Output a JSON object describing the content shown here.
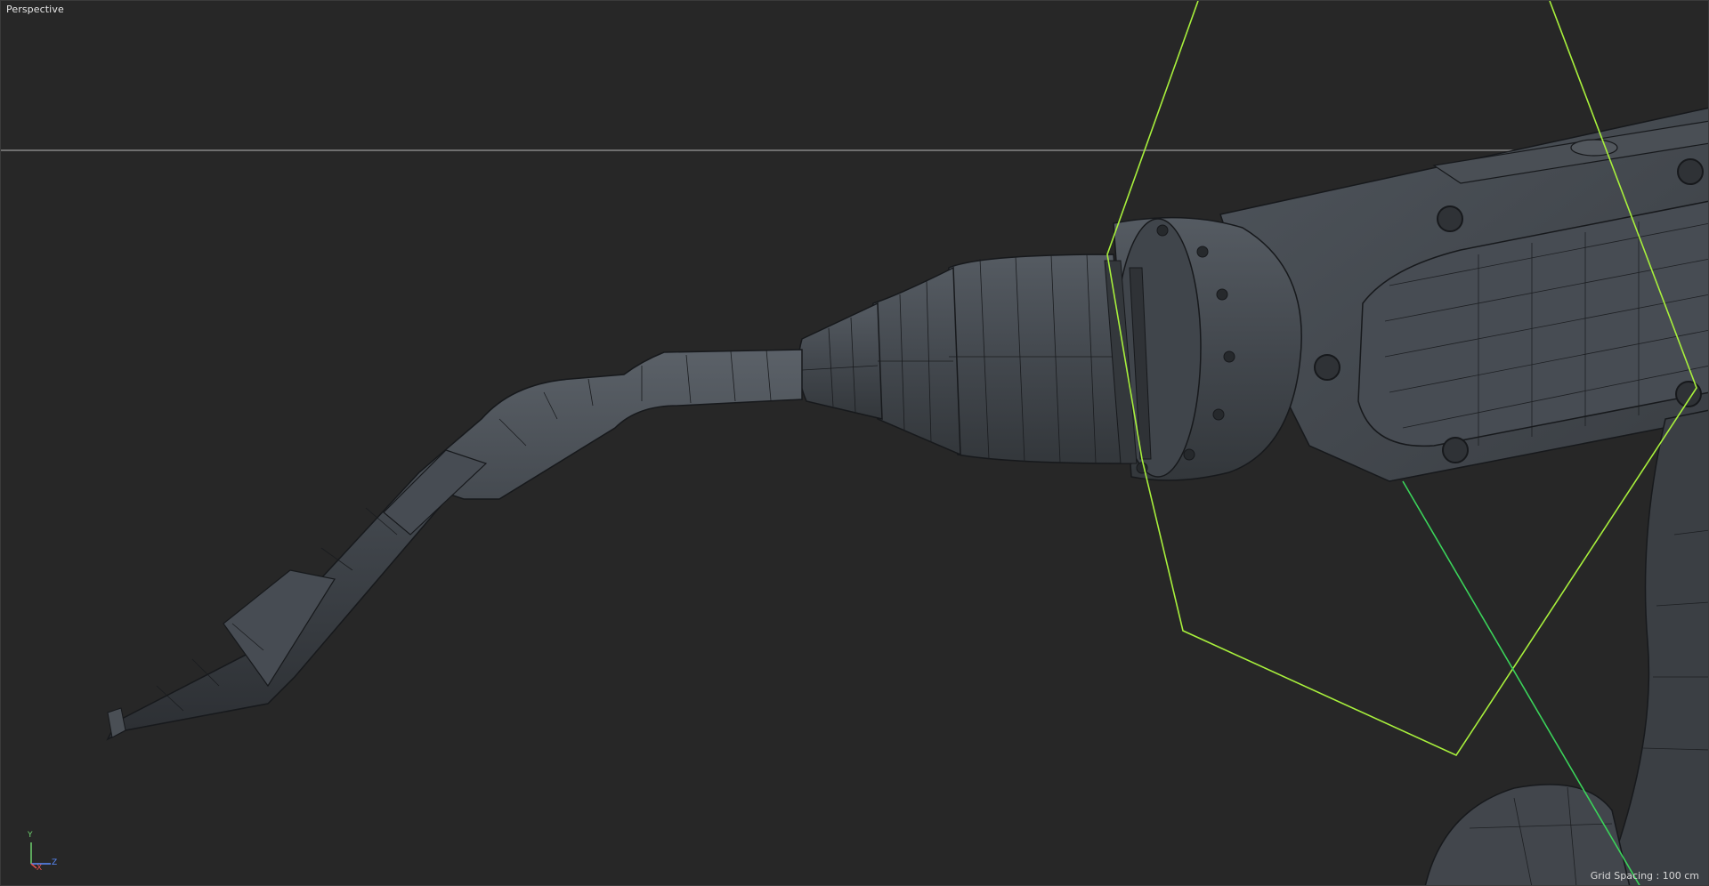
{
  "viewport": {
    "view_name": "Perspective",
    "grid_spacing_text": "Grid Spacing : 100 cm"
  },
  "axis_gizmo": {
    "y_label": "Y",
    "z_label": "Z",
    "x_label": "X",
    "colors": {
      "y": "#6fd26f",
      "z": "#5a8cff",
      "x": "#e05050"
    }
  },
  "colors": {
    "background": "#272727",
    "horizon_line": "#9a9a9a",
    "selection_frame": "#a8f03c",
    "joint_axis": "#3bd35a",
    "mesh_fill": "#3d4147",
    "mesh_wire": "#16181b"
  }
}
